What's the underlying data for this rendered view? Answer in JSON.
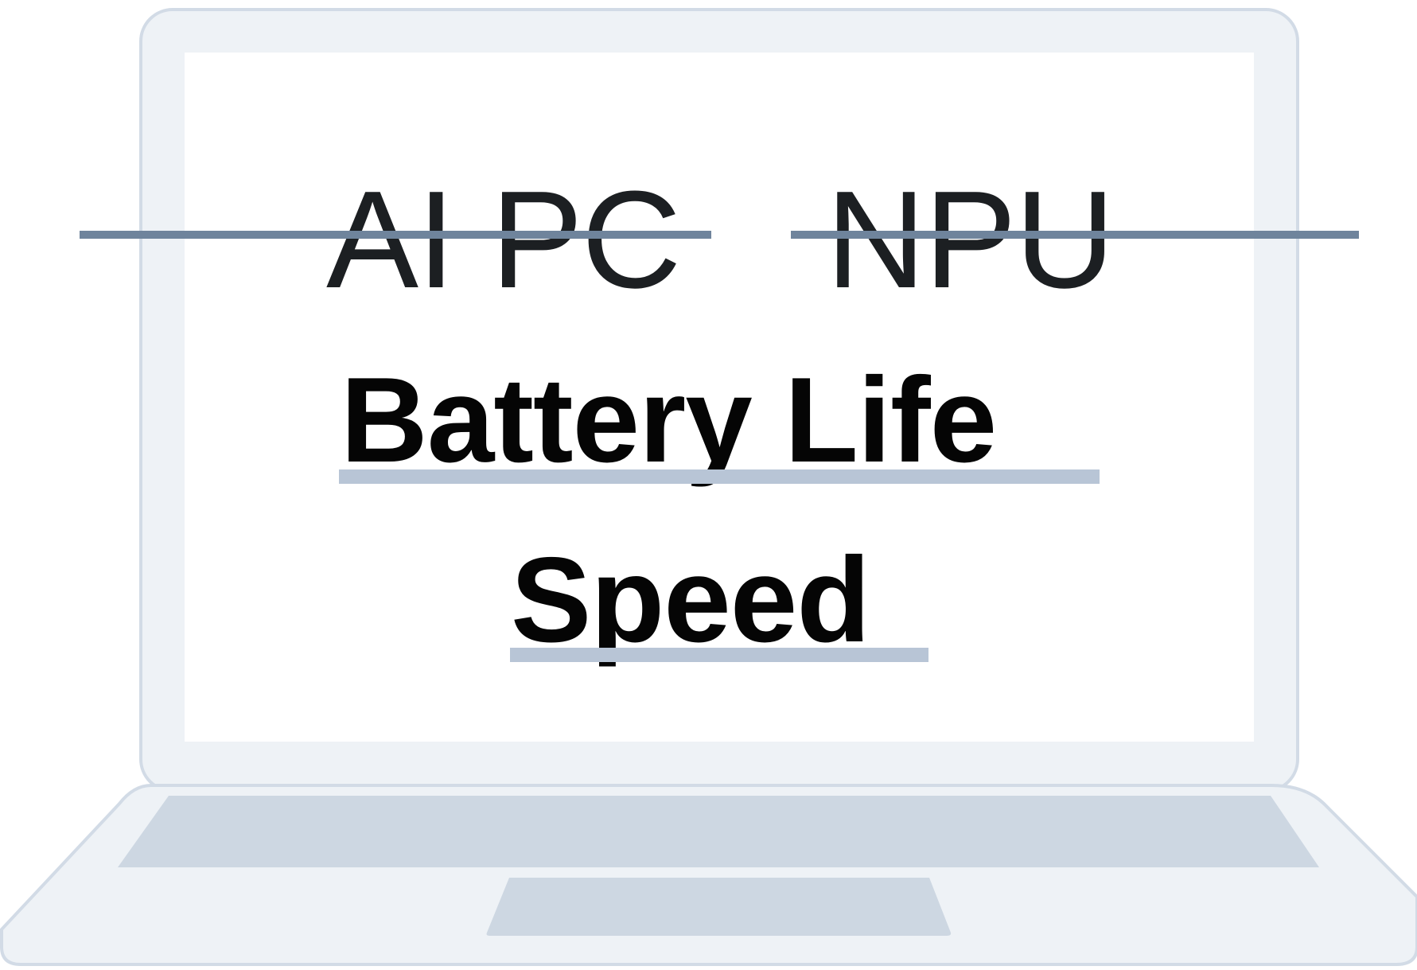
{
  "screen": {
    "struck_terms": [
      "AI PC",
      "NPU"
    ],
    "emphasized_terms": [
      "Battery Life",
      "Speed"
    ]
  },
  "colors": {
    "laptop_outline": "#d2dbe6",
    "laptop_body": "#eef2f6",
    "keyboard_deck": "#cdd7e2",
    "strike_line": "#6f849c",
    "underline": "#b8c5d6",
    "text_struck": "#1c1f22",
    "text_emphasis": "#050505"
  }
}
